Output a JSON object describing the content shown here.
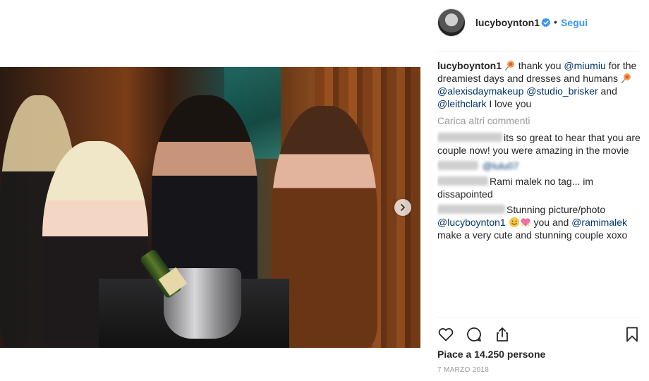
{
  "post": {
    "username": "lucyboynton1",
    "separator": "•",
    "follow_label": "Segui",
    "caption": {
      "username": "lucyboynton1",
      "part1": "thank you ",
      "mention1": "@miumiu",
      "part2": " for the dreamiest days and dresses and humans ",
      "mention2": "@alexisdaymakeup",
      "mention3": "@studio_brisker",
      "part3": " and ",
      "mention4": "@leithclark",
      "part4": " I love you"
    },
    "load_more_label": "Carica altri commenti",
    "comments": [
      {
        "text_a": "its so great to hear that you are couple now! you were amazing in the movie"
      },
      {
        "mention": "@lulu07"
      },
      {
        "text_a": "Rami malek no tag... im dissapointed"
      },
      {
        "text_a": "Stunning picture/photo ",
        "mention_a": "@lucyboynton1",
        "text_b": " you and ",
        "mention_b": "@ramimalek",
        "text_c": " make a very cute and stunning couple xoxo"
      }
    ],
    "likes_label": "Piace a 14.250 persone",
    "date_label": "7 MARZO 2018"
  },
  "icons": {
    "like": "heart-icon",
    "comment": "comment-bubble-icon",
    "share": "share-upload-icon",
    "save": "bookmark-icon",
    "next": "chevron-right-icon",
    "verified": "verified-badge-icon"
  },
  "colors": {
    "accent": "#3897f0",
    "mention": "#003569",
    "muted": "#999999",
    "text": "#262626"
  }
}
